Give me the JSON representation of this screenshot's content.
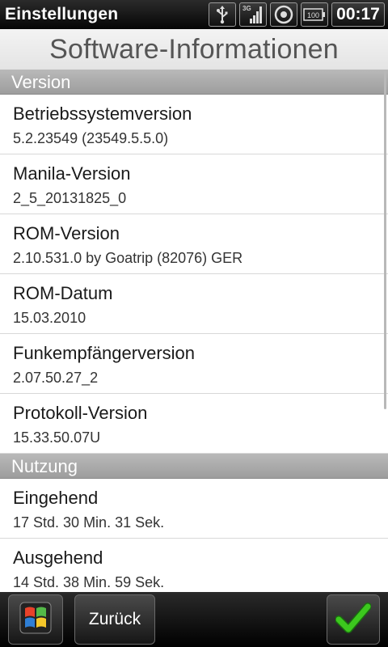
{
  "status_bar": {
    "app_title": "Einstellungen",
    "network_label": "3G",
    "battery_text": "100",
    "clock": "00:17",
    "icons": [
      "usb-icon",
      "signal-3g-icon",
      "sync-icon",
      "battery-icon"
    ]
  },
  "page": {
    "title": "Software-Informationen"
  },
  "sections": [
    {
      "header": "Version",
      "items": [
        {
          "label": "Betriebssystemversion",
          "value": "5.2.23549 (23549.5.5.0)"
        },
        {
          "label": "Manila-Version",
          "value": "2_5_20131825_0"
        },
        {
          "label": "ROM-Version",
          "value": "2.10.531.0 by Goatrip (82076) GER"
        },
        {
          "label": "ROM-Datum",
          "value": "15.03.2010"
        },
        {
          "label": "Funkempfängerversion",
          "value": "2.07.50.27_2"
        },
        {
          "label": "Protokoll-Version",
          "value": "15.33.50.07U"
        }
      ]
    },
    {
      "header": "Nutzung",
      "items": [
        {
          "label": "Eingehend",
          "value": "17 Std. 30 Min. 31 Sek."
        },
        {
          "label": "Ausgehend",
          "value": "14 Std. 38 Min. 59 Sek."
        }
      ]
    }
  ],
  "bottom_bar": {
    "start_icon": "windows-start-icon",
    "back_label": "Zurück",
    "ok_icon": "checkmark-icon"
  },
  "colors": {
    "section_header": "#a9a9a9",
    "status_bar": "#111111",
    "checkmark": "#3cc81e"
  }
}
